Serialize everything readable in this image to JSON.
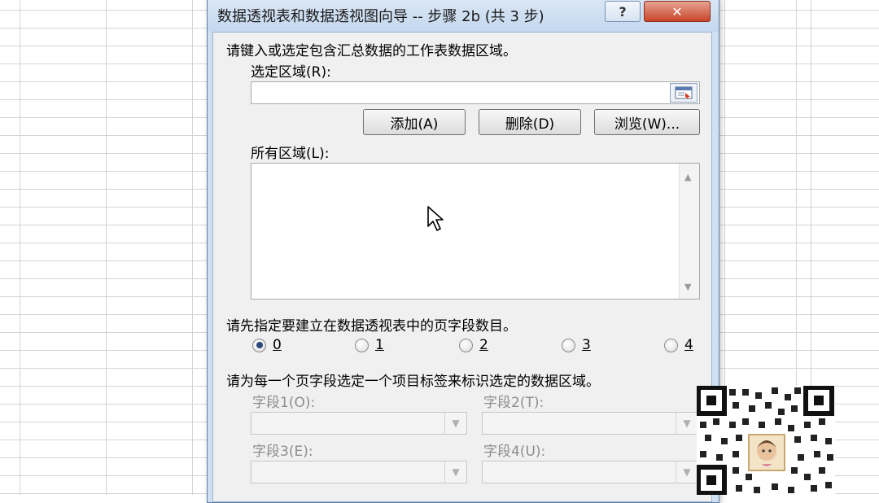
{
  "dialog": {
    "title": "数据透视表和数据透视图向导 -- 步骤 2b (共 3 步)",
    "help_label": "?",
    "close_label": "✕",
    "instruction_range": "请键入或选定包含汇总数据的工作表数据区域。",
    "range_label": "选定区域(R):",
    "range_value": "",
    "add_button": "添加(A)",
    "delete_button": "删除(D)",
    "browse_button": "浏览(W)...",
    "all_ranges_label": "所有区域(L):",
    "page_fields_instruction": "请先指定要建立在数据透视表中的页字段数目。",
    "page_field_options": [
      "0",
      "1",
      "2",
      "3",
      "4"
    ],
    "page_field_selected": "0",
    "label_instruction": "请为每一个页字段选定一个项目标签来标识选定的数据区域。",
    "field1_label": "字段1(O):",
    "field2_label": "字段2(T):",
    "field3_label": "字段3(E):",
    "field4_label": "字段4(U):"
  }
}
